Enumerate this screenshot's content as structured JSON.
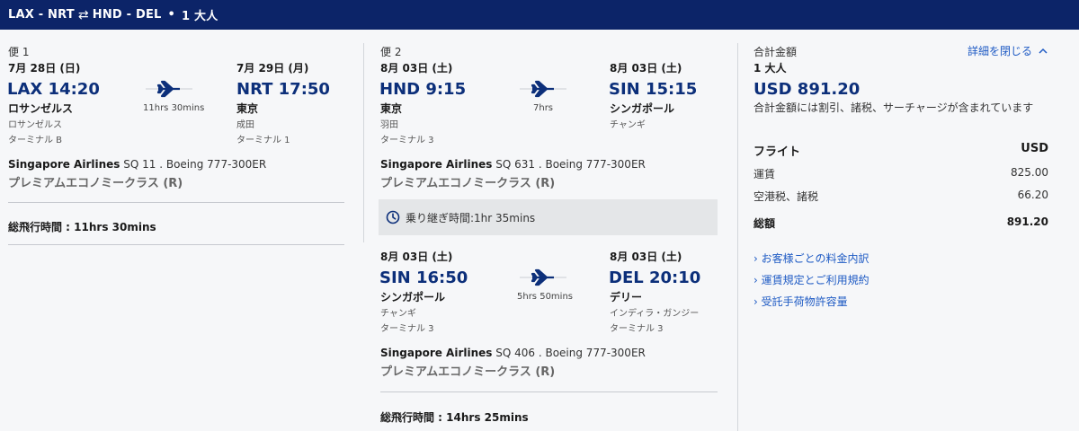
{
  "header": {
    "origin": "LAX",
    "dest1": "NRT",
    "swap_icon": "round-trip-arrows-icon",
    "origin2": "HND",
    "dest2": "DEL",
    "passengers": "1 大人"
  },
  "flight1": {
    "label": "便 1",
    "segment": {
      "dep_date": "7月 28日 (日)",
      "dep_time": "LAX 14:20",
      "dep_city": "ロサンゼルス",
      "dep_airport": "ロサンゼルス",
      "dep_terminal": "ターミナル B",
      "duration": "11hrs 30mins",
      "arr_date": "7月 29日 (月)",
      "arr_time": "NRT 17:50",
      "arr_city": "東京",
      "arr_airport": "成田",
      "arr_terminal": "ターミナル 1",
      "airline": "Singapore Airlines",
      "flight_info": " SQ 11 . Boeing 777-300ER",
      "cabin": "プレミアムエコノミークラス (R)"
    },
    "total_label": "総飛行時間 : 11hrs 30mins"
  },
  "flight2": {
    "label": "便 2",
    "segment1": {
      "dep_date": "8月 03日 (土)",
      "dep_time": "HND 9:15",
      "dep_city": "東京",
      "dep_airport": "羽田",
      "dep_terminal": "ターミナル 3",
      "duration": "7hrs",
      "arr_date": "8月 03日 (土)",
      "arr_time": "SIN 15:15",
      "arr_city": "シンガポール",
      "arr_airport": "チャンギ",
      "airline": "Singapore Airlines",
      "flight_info": " SQ 631 . Boeing 777-300ER",
      "cabin": "プレミアムエコノミークラス (R)"
    },
    "layover": "乗り継ぎ時間:1hr 35mins",
    "segment2": {
      "dep_date": "8月 03日 (土)",
      "dep_time": "SIN 16:50",
      "dep_city": "シンガポール",
      "dep_airport": "チャンギ",
      "dep_terminal": "ターミナル 3",
      "duration": "5hrs 50mins",
      "arr_date": "8月 03日 (土)",
      "arr_time": "DEL 20:10",
      "arr_city": "デリー",
      "arr_airport": "インディラ・ガンジー",
      "arr_terminal": "ターミナル 3",
      "airline": "Singapore Airlines",
      "flight_info": " SQ 406 . Boeing 777-300ER",
      "cabin": "プレミアムエコノミークラス (R)"
    },
    "total_label": "総飛行時間 : 14hrs 25mins"
  },
  "summary": {
    "title": "合計金額",
    "close_link": "詳細を閉じる",
    "passengers": "1 大人",
    "total_price": "USD 891.20",
    "note": "合計金額には割引、諸税、サーチャージが含まれています",
    "flight_label": "フライト",
    "currency": "USD",
    "rows": [
      {
        "label": "運賃",
        "value": "825.00"
      },
      {
        "label": "空港税、諸税",
        "value": "66.20"
      }
    ],
    "total_label": "総額",
    "total_value": "891.20",
    "links": [
      "お客様ごとの料金内訳",
      "運賃規定とご利用規約",
      "受託手荷物許容量"
    ]
  }
}
